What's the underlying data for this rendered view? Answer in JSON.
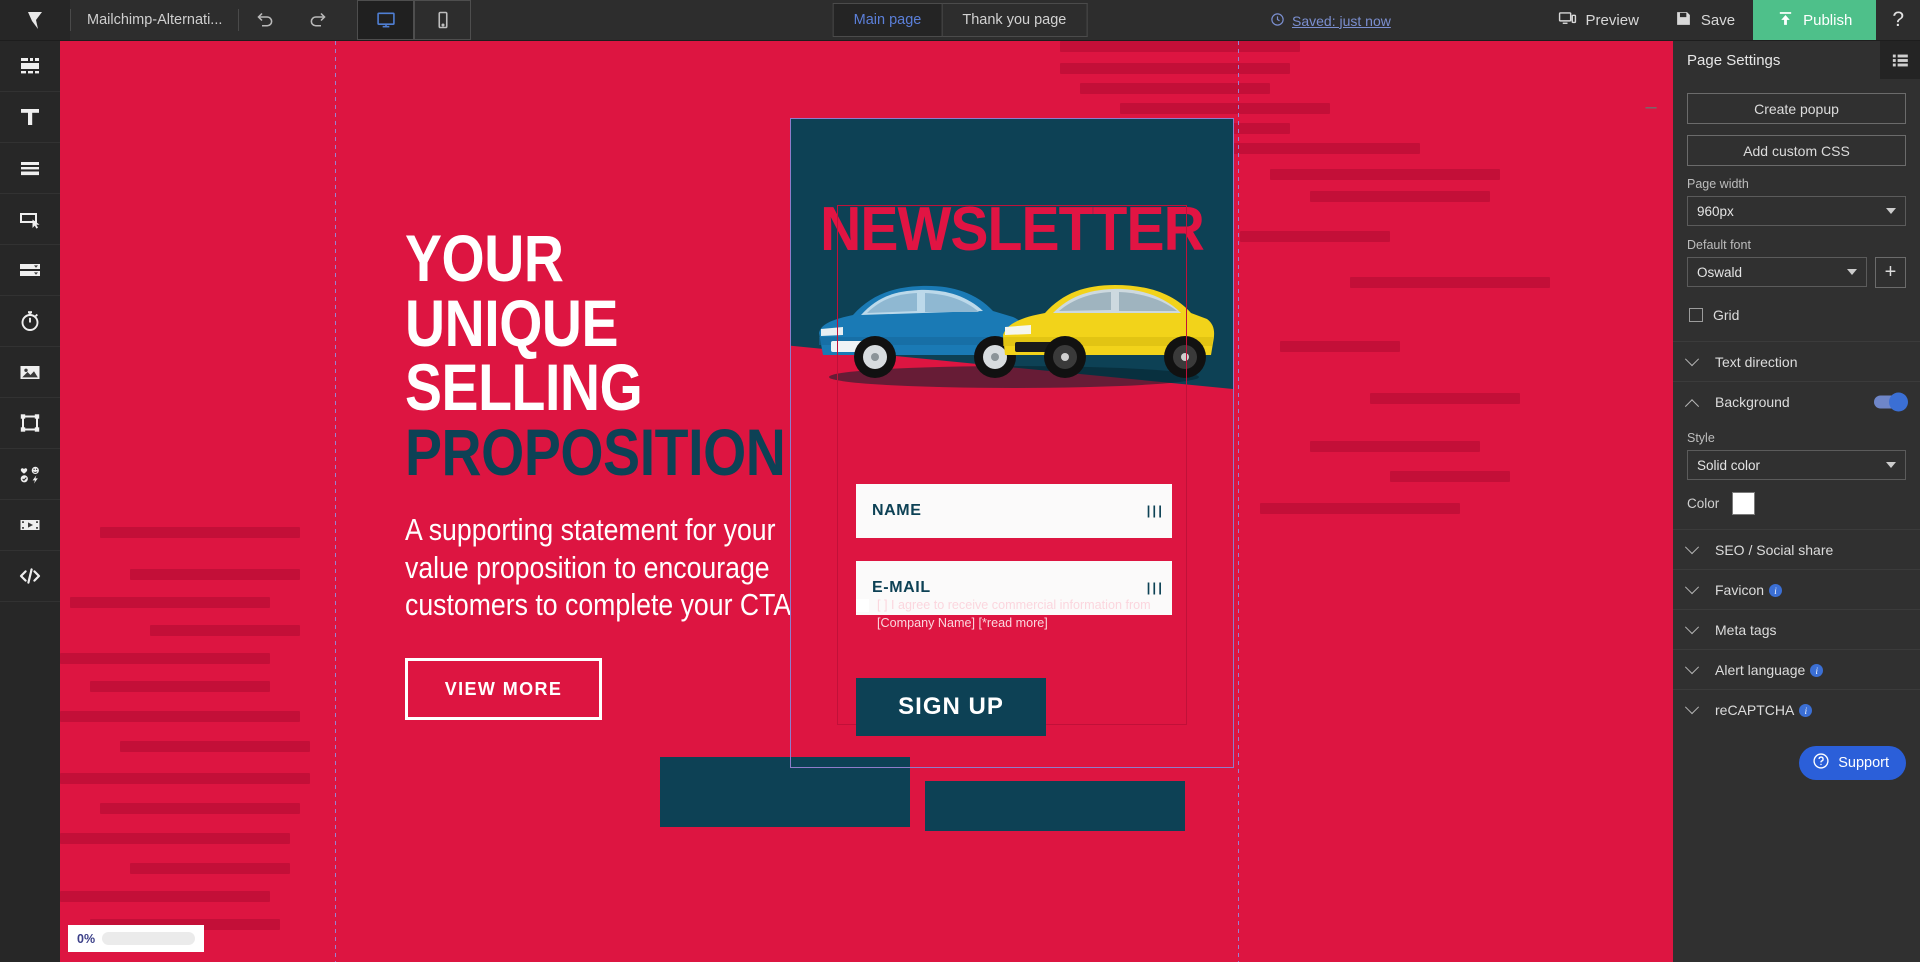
{
  "topbar": {
    "logo_icon": "landingi-logo-icon",
    "project_title": "Mailchimp-Alternati...",
    "undo_icon": "undo-icon",
    "redo_icon": "redo-icon",
    "desktop_icon": "desktop-view-icon",
    "mobile_icon": "mobile-view-icon",
    "tabs": [
      {
        "label": "Main page",
        "active": true
      },
      {
        "label": "Thank you page",
        "active": false
      }
    ],
    "saved_status": "Saved: just now",
    "saved_icon": "clock-history-icon",
    "preview_label": "Preview",
    "preview_icon": "preview-monitor-icon",
    "save_label": "Save",
    "save_icon": "floppy-disk-icon",
    "publish_label": "Publish",
    "publish_icon": "upload-arrow-icon",
    "help_label": "?",
    "publish_color": "#4ec08a",
    "accent_blue": "#5b7fd8"
  },
  "left_rail": [
    {
      "name": "sections-icon",
      "title": "Sections"
    },
    {
      "name": "text-icon",
      "title": "Text"
    },
    {
      "name": "boxes-icon",
      "title": "Boxes"
    },
    {
      "name": "button-icon",
      "title": "Button"
    },
    {
      "name": "form-icon",
      "title": "Form"
    },
    {
      "name": "countdown-timer-icon",
      "title": "Countdown"
    },
    {
      "name": "image-icon",
      "title": "Image"
    },
    {
      "name": "shape-icon",
      "title": "Shape"
    },
    {
      "name": "icons-icon",
      "title": "Icons"
    },
    {
      "name": "video-icon",
      "title": "Video"
    },
    {
      "name": "code-icon",
      "title": "HTML code"
    }
  ],
  "canvas": {
    "background_color": "#dd1541",
    "teal_color": "#0d4155",
    "minus_label": "–",
    "hero": {
      "line1": "YOUR",
      "line2": "UNIQUE SELLING",
      "line3": "PROPOSITION",
      "paragraph": "A supporting statement for your value proposition to encourage customers to complete your CTA",
      "cta_label": "VIEW MORE"
    },
    "form": {
      "title": "NEWSLETTER",
      "name_field": "NAME",
      "email_field": "E-MAIL",
      "consent_text": "[ ] I agree to receive commercial information from [Company Name] [*read more]",
      "submit_label": "SIGN UP",
      "image_alt": "two-cars-blue-and-yellow"
    },
    "progress": {
      "percent_label": "0%"
    }
  },
  "right_panel": {
    "title": "Page Settings",
    "list_icon": "list-view-icon",
    "create_popup_label": "Create popup",
    "add_custom_css_label": "Add custom CSS",
    "page_width_label": "Page width",
    "page_width_value": "960px",
    "default_font_label": "Default font",
    "default_font_value": "Oswald",
    "add_font_label": "+",
    "grid_label": "Grid",
    "grid_checked": false,
    "sections": [
      {
        "label": "Text direction",
        "expanded": false,
        "info": false,
        "toggle": false
      },
      {
        "label": "Background",
        "expanded": true,
        "info": false,
        "toggle": true
      },
      {
        "label": "SEO / Social share",
        "expanded": false,
        "info": false,
        "toggle": false
      },
      {
        "label": "Favicon",
        "expanded": false,
        "info": true,
        "toggle": false
      },
      {
        "label": "Meta tags",
        "expanded": false,
        "info": false,
        "toggle": false
      },
      {
        "label": "Alert language",
        "expanded": false,
        "info": true,
        "toggle": false
      },
      {
        "label": "reCAPTCHA",
        "expanded": false,
        "info": true,
        "toggle": false
      }
    ],
    "background": {
      "style_label": "Style",
      "style_value": "Solid color",
      "color_label": "Color",
      "color_value": "#ffffff"
    },
    "support_label": "Support",
    "support_icon": "question-circle-icon"
  }
}
